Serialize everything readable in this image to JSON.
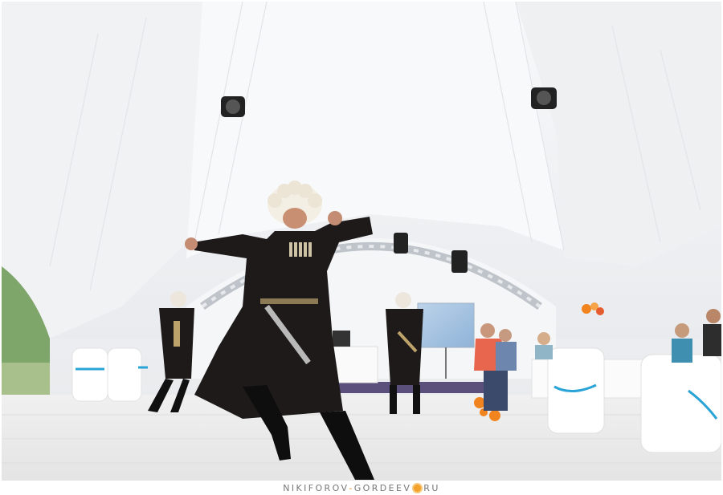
{
  "watermark": {
    "part1": "NIKIFOROV",
    "dash1": "-",
    "part2": "GORDEEV",
    "part3": "RU",
    "accent_color": "#e98b20",
    "icon": "sun-icon"
  },
  "palette": {
    "tent": "#f3f4f6",
    "floor": "#ececec",
    "costume": "#1e1a1a",
    "shirt_red": "#e9664e",
    "ribbon": "#2aa4d6",
    "orange": "#f2841f"
  }
}
